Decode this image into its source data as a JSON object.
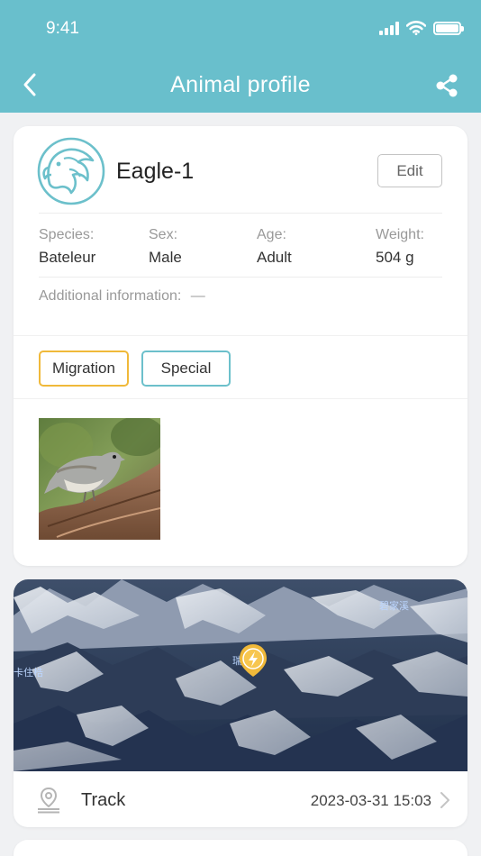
{
  "status_bar": {
    "time": "9:41"
  },
  "header": {
    "title": "Animal profile"
  },
  "profile": {
    "name": "Eagle-1",
    "edit_label": "Edit",
    "fields": [
      {
        "label": "Species:",
        "value": "Bateleur"
      },
      {
        "label": "Sex:",
        "value": "Male"
      },
      {
        "label": "Age:",
        "value": "Adult"
      },
      {
        "label": "Weight:",
        "value": "504 g"
      }
    ],
    "additional_label": "Additional information:",
    "additional_value": "—",
    "tags": [
      "Migration",
      "Special"
    ]
  },
  "map": {
    "place_labels": [
      "卡住梏",
      "碧家溪",
      "瑞丰镇"
    ]
  },
  "track": {
    "label": "Track",
    "timestamp": "2023-03-31 15:03"
  },
  "colors": {
    "header": "#69bfcc",
    "accent_yellow": "#f0b93a",
    "accent_teal": "#6cc0cb"
  },
  "icons": [
    "back-arrow-icon",
    "share-icon",
    "eagle-avatar-icon",
    "location-pin-icon",
    "chevron-right-icon"
  ]
}
